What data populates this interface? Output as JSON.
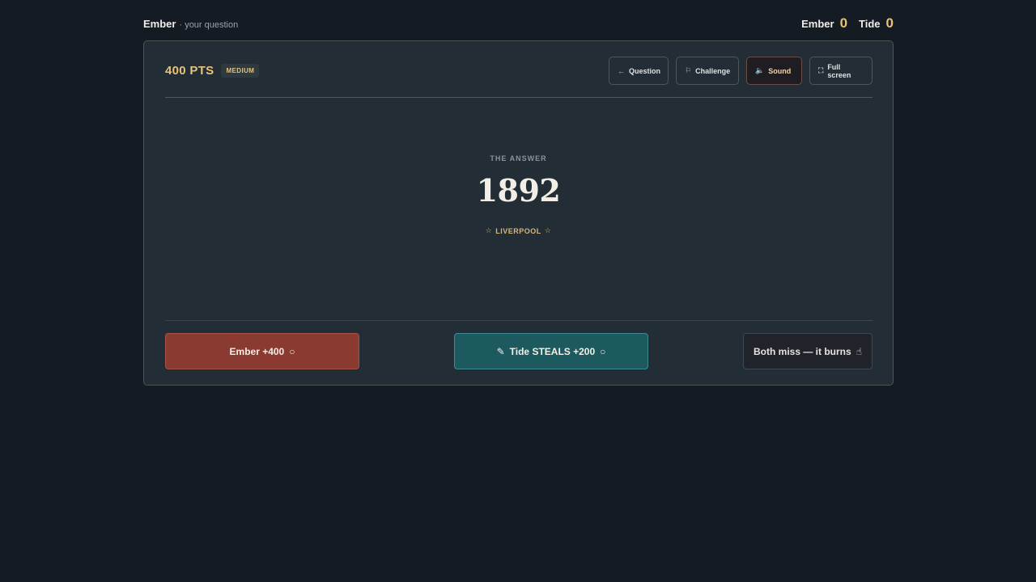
{
  "topbar": {
    "turn_team": "Ember",
    "turn_sub": "· your question",
    "scores": [
      {
        "name": "Ember",
        "value": "0"
      },
      {
        "name": "Tide",
        "value": "0"
      }
    ]
  },
  "card": {
    "points": "400 PTS",
    "difficulty": "MEDIUM",
    "actions": {
      "question": {
        "label": "Question",
        "icon": "←"
      },
      "challenge": {
        "label": "Challenge",
        "icon": "⚐"
      },
      "sound": {
        "label": "Sound",
        "icon": "🔈"
      },
      "fullscreen": {
        "label": "Full screen",
        "icon": "⛶"
      }
    },
    "answer": {
      "eyebrow": "THE ANSWER",
      "value": "1892",
      "source": "LIVERPOOL",
      "star_icon": "☆"
    },
    "scoring": {
      "ember": {
        "label": "Ember +400",
        "icon": "○"
      },
      "tide": {
        "label": "Tide STEALS +200",
        "lead_icon": "✎",
        "icon": "○"
      },
      "miss": {
        "label": "Both miss — it burns",
        "icon": "☝"
      }
    }
  },
  "colors": {
    "background": "#151b22",
    "card": "#222d35",
    "gold": "#e9c27a",
    "ember": "#8a3a30",
    "tide": "#1d5a60"
  }
}
